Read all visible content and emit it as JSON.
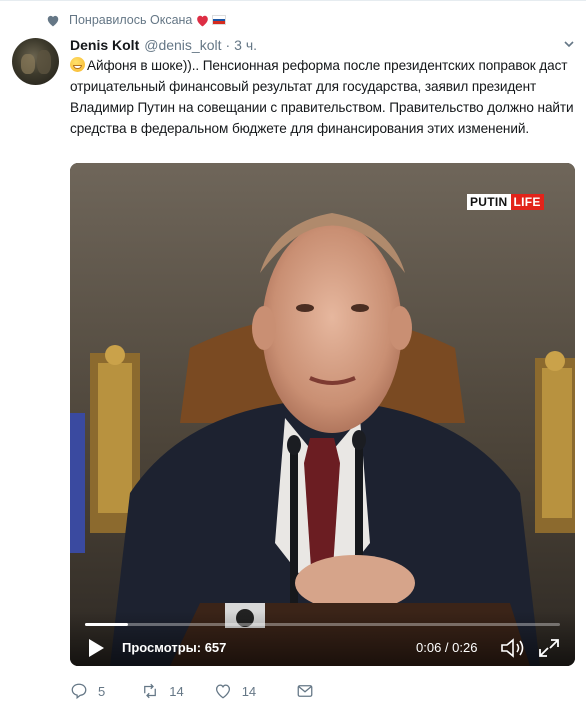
{
  "social_context": {
    "text": "Понравилось Оксана",
    "icon": "heart-icon",
    "emoji": [
      "red-heart-emoji",
      "russia-flag-emoji"
    ]
  },
  "tweet": {
    "author_name": "Denis Kolt",
    "author_handle": "@denis_kolt",
    "separator": "·",
    "time": "3 ч.",
    "text": "Айфоня в шоке)).. Пенсионная реформа после президентских поправок даст отрицательный финансовый результат для государства, заявил президент Владимир Путин на совещании с правительством. Правительство должно найти средства в федеральном бюджете для финансирования этих изменений.",
    "leading_emoji": "grinning-face-emoji"
  },
  "video": {
    "brand_left": "PUTIN",
    "brand_right": "LIFE",
    "views_text": "Просмотры: 657",
    "time_text": "0:06 / 0:26",
    "progress_fraction": 0.09
  },
  "actions": {
    "reply_count": "5",
    "retweet_count": "14",
    "like_count": "14"
  },
  "colors": {
    "muted": "#657786",
    "brand_red": "#e2231a",
    "heart_red": "#e0245e"
  }
}
